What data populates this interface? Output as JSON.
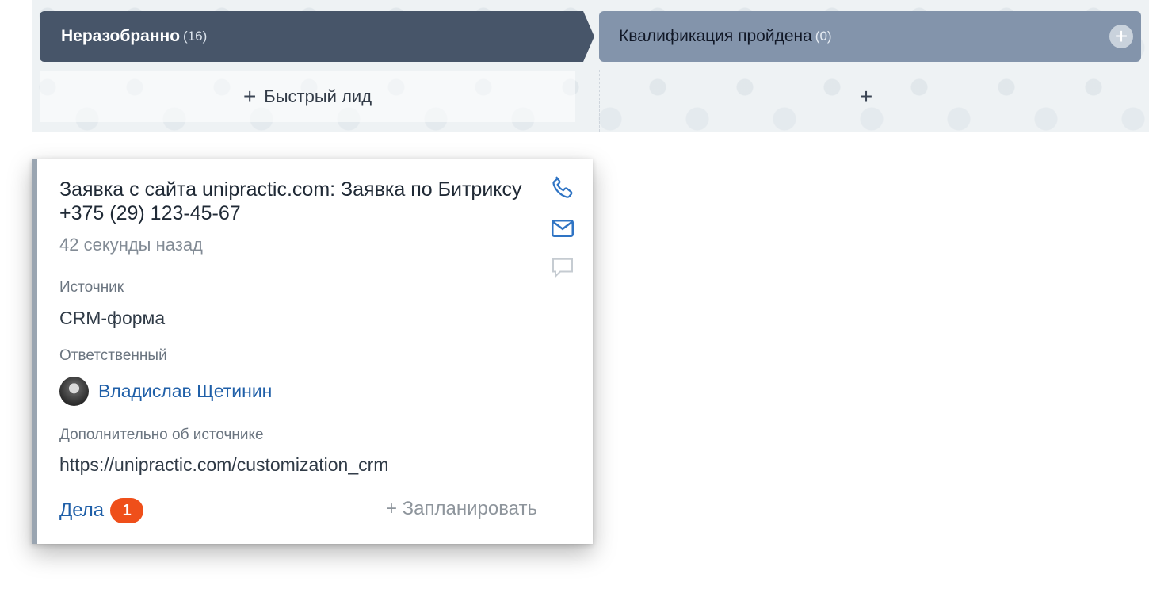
{
  "stages": [
    {
      "name": "Неразобранно",
      "count": "(16)",
      "quick_add": "Быстрый лид",
      "quick_plus": "+"
    },
    {
      "name": "Квалификация пройдена",
      "count": "(0)",
      "add": "+",
      "quick_plus": "+"
    }
  ],
  "card": {
    "title": "Заявка с сайта unipractic.com: Заявка по Битриксу +375 (29) 123-45-67",
    "time": "42 секунды назад",
    "source_label": "Источник",
    "source_value": "CRM-форма",
    "responsible_label": "Ответственный",
    "responsible_name": "Владислав Щетинин",
    "extra_label": "Дополнительно об источнике",
    "extra_value": "https://unipractic.com/customization_crm",
    "deals_label": "Дела",
    "deals_count": "1",
    "plan_label": "+ Запланировать"
  },
  "icons": [
    "phone-icon",
    "mail-icon",
    "chat-icon"
  ],
  "colors": {
    "stage_active": "#475569",
    "stage_inactive": "#8394ab",
    "link": "#1f5fa8",
    "badge": "#ef4f1a"
  }
}
